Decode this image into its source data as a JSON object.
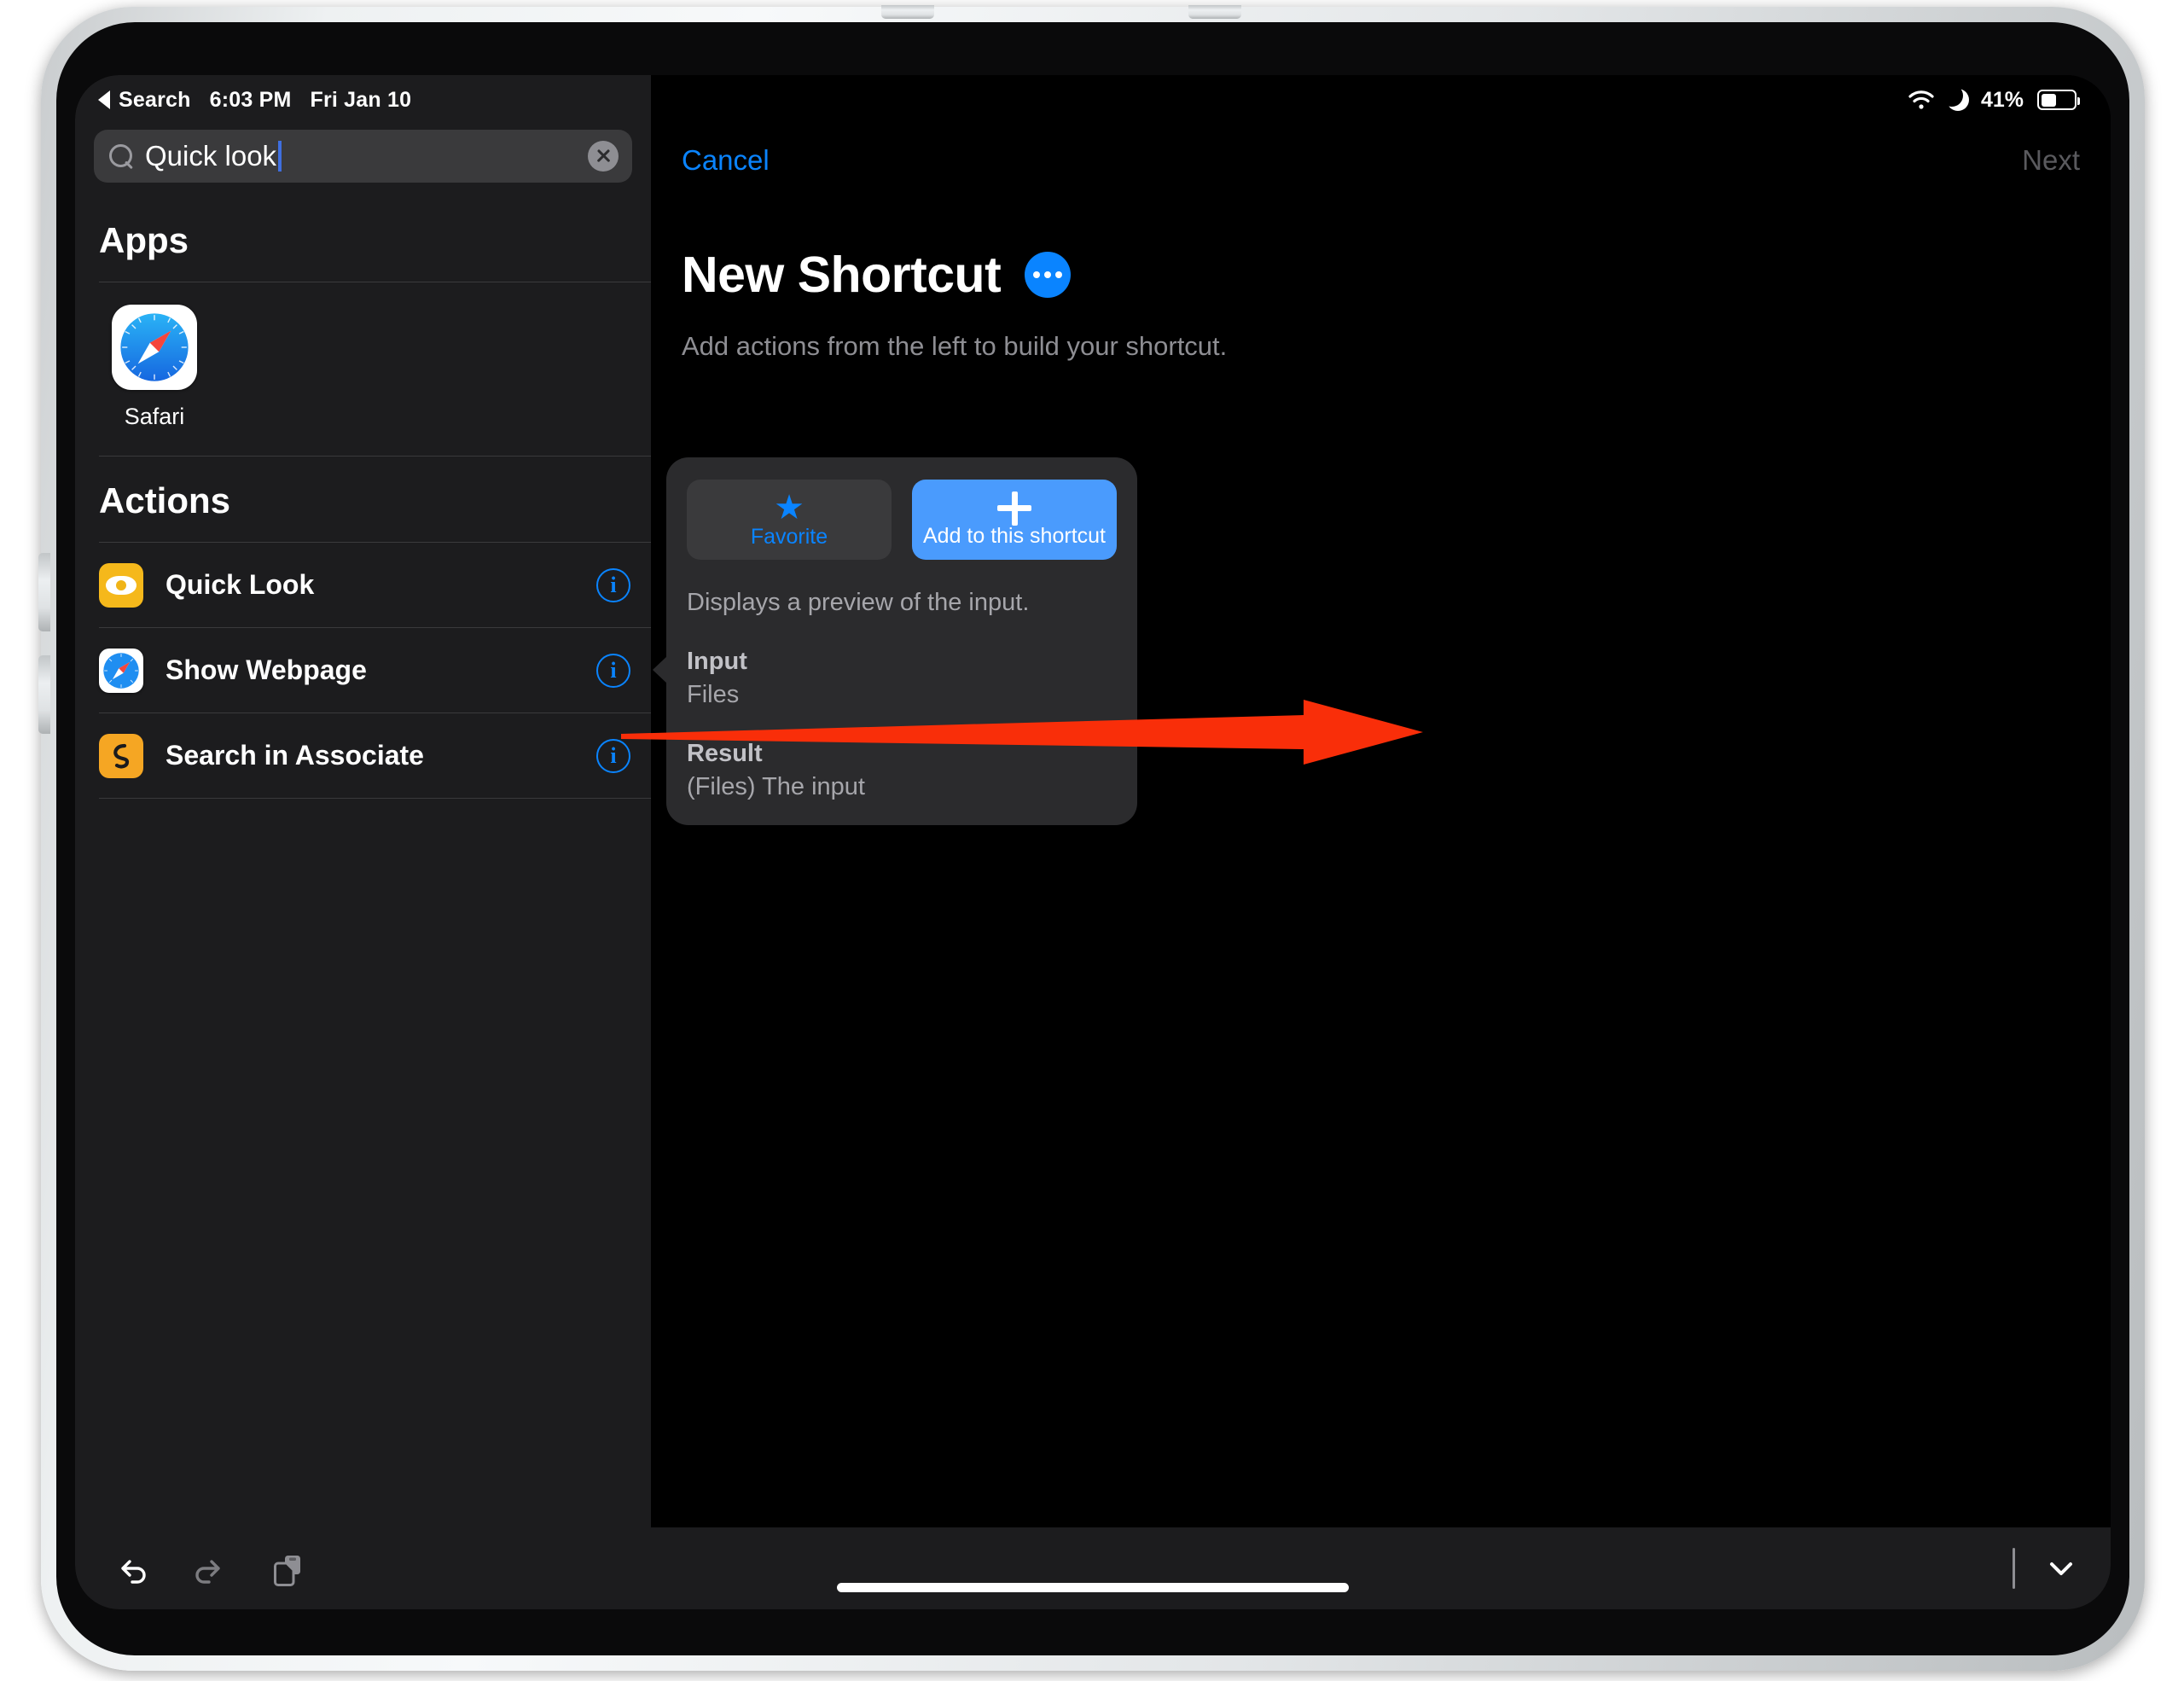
{
  "status_bar": {
    "back_label": "Search",
    "time": "6:03 PM",
    "date": "Fri Jan 10",
    "wifi_icon": "wifi-icon",
    "dnd_icon": "moon-icon",
    "battery_percent": "41%",
    "battery_icon": "battery-icon"
  },
  "search": {
    "icon": "search-icon",
    "value": "Quick look",
    "clear_icon": "clear-icon"
  },
  "sidebar": {
    "apps_section_title": "Apps",
    "apps": [
      {
        "label": "Safari",
        "icon": "safari-icon"
      }
    ],
    "actions_section_title": "Actions",
    "actions": [
      {
        "label": "Quick Look",
        "icon": "eye-icon",
        "icon_color": "#f5b81b",
        "info_label": "i"
      },
      {
        "label": "Show Webpage",
        "icon": "safari-icon",
        "icon_color": "#ffffff",
        "info_label": "i"
      },
      {
        "label": "Search in Associate",
        "icon": "associate-icon",
        "icon_color": "#f5a623",
        "info_label": "i"
      }
    ]
  },
  "editor": {
    "cancel_label": "Cancel",
    "next_label": "Next",
    "title": "New Shortcut",
    "options_icon": "ellipsis-icon",
    "subtitle": "Add actions from the left to build your shortcut."
  },
  "popover": {
    "favorite_label": "Favorite",
    "favorite_icon": "star-icon",
    "add_label": "Add to this shortcut",
    "add_icon": "plus-icon",
    "description": "Displays a preview of the input.",
    "input_label": "Input",
    "input_value": "Files",
    "result_label": "Result",
    "result_value": "(Files) The input"
  },
  "toolbar": {
    "undo_icon": "undo-icon",
    "redo_icon": "redo-icon",
    "paste_icon": "paste-icon",
    "dismiss_keyboard_icon": "chevron-down-icon"
  },
  "annotation": {
    "arrow_color": "#f92e09"
  },
  "colors": {
    "accent_blue": "#0a84ff",
    "panel_bg": "#1c1c1e",
    "popover_bg": "#2b2b2d",
    "screen_bg": "#000000"
  }
}
